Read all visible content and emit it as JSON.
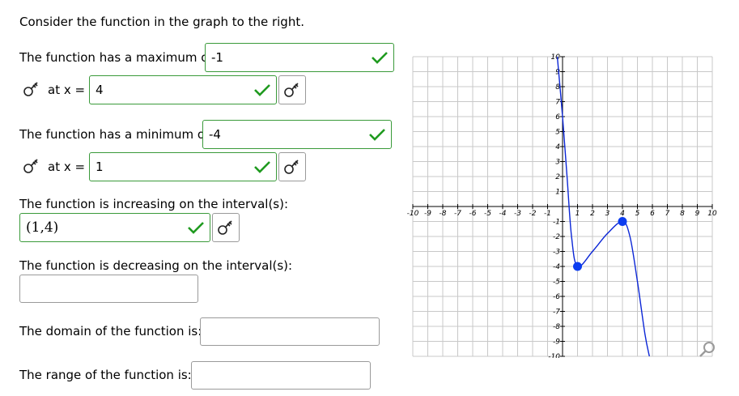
{
  "intro": "Consider the function in the graph to the right.",
  "max": {
    "label": "The function has a maximum of",
    "value": "-1",
    "at_label": "at x =",
    "at_value": "4"
  },
  "min": {
    "label": "The function has a minimum of",
    "value": "-4",
    "at_label": "at x =",
    "at_value": "1"
  },
  "increasing": {
    "label": "The function is increasing on the interval(s):",
    "value": "(1,4)"
  },
  "decreasing": {
    "label": "The function is decreasing on the interval(s):",
    "value": ""
  },
  "domain": {
    "label": "The domain of the function is:",
    "value": ""
  },
  "range": {
    "label": "The range of the function is:",
    "value": ""
  },
  "icons": {
    "key": "keyboard-toggle-icon",
    "check": "check-icon",
    "zoom": "magnify-icon"
  },
  "colors": {
    "correct_border": "#3a9a3a",
    "check": "#1f9a1f",
    "curve": "#0b26d6",
    "point": "#0b3cf0",
    "grid": "#c8c8c8"
  },
  "chart_data": {
    "type": "line",
    "title": "",
    "xlabel": "",
    "ylabel": "",
    "xlim": [
      -10,
      10
    ],
    "ylim": [
      -10,
      10
    ],
    "grid": true,
    "x_tick_labels": [
      "-10",
      "-9",
      "-8",
      "-7",
      "-6",
      "-5",
      "-4",
      "-3",
      "-2",
      "-1",
      "1",
      "2",
      "3",
      "4",
      "5",
      "6",
      "7",
      "8",
      "9",
      "10"
    ],
    "y_tick_labels": [
      "10",
      "9",
      "8",
      "7",
      "6",
      "5",
      "4",
      "3",
      "2",
      "1",
      "-1",
      "-2",
      "-3",
      "-4",
      "-5",
      "-6",
      "-7",
      "-8",
      "-9",
      "-10"
    ],
    "series": [
      {
        "points": [
          [
            -0.35,
            10
          ],
          [
            0,
            6
          ],
          [
            0.3,
            2
          ],
          [
            0.6,
            -2
          ],
          [
            1,
            -4
          ],
          [
            2,
            -3
          ],
          [
            3,
            -1.8
          ],
          [
            4,
            -1
          ],
          [
            4.5,
            -2
          ],
          [
            5,
            -5
          ],
          [
            5.5,
            -8.5
          ],
          [
            5.8,
            -10
          ]
        ]
      }
    ],
    "highlighted_points": [
      [
        1,
        -4
      ],
      [
        4,
        -1
      ]
    ]
  }
}
